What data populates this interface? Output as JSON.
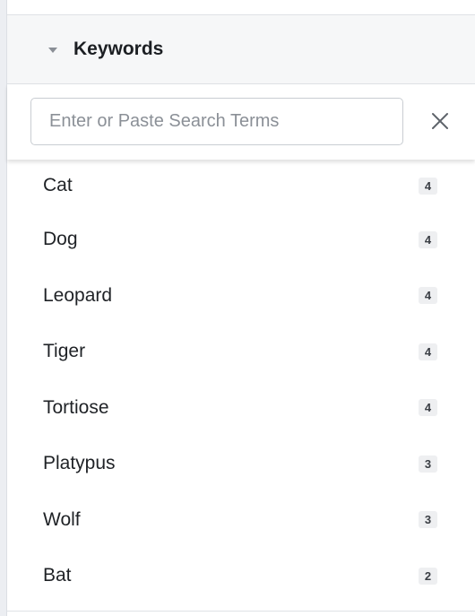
{
  "keywords_panel": {
    "title": "Keywords",
    "search": {
      "placeholder": "Enter or Paste Search Terms",
      "value": ""
    },
    "clear_icon": "close-icon",
    "items": [
      {
        "label": "Cat",
        "count": "4"
      },
      {
        "label": "Dog",
        "count": "4"
      },
      {
        "label": "Leopard",
        "count": "4"
      },
      {
        "label": "Tiger",
        "count": "4"
      },
      {
        "label": "Tortiose",
        "count": "4"
      },
      {
        "label": "Platypus",
        "count": "3"
      },
      {
        "label": "Wolf",
        "count": "3"
      },
      {
        "label": "Bat",
        "count": "2"
      }
    ]
  }
}
